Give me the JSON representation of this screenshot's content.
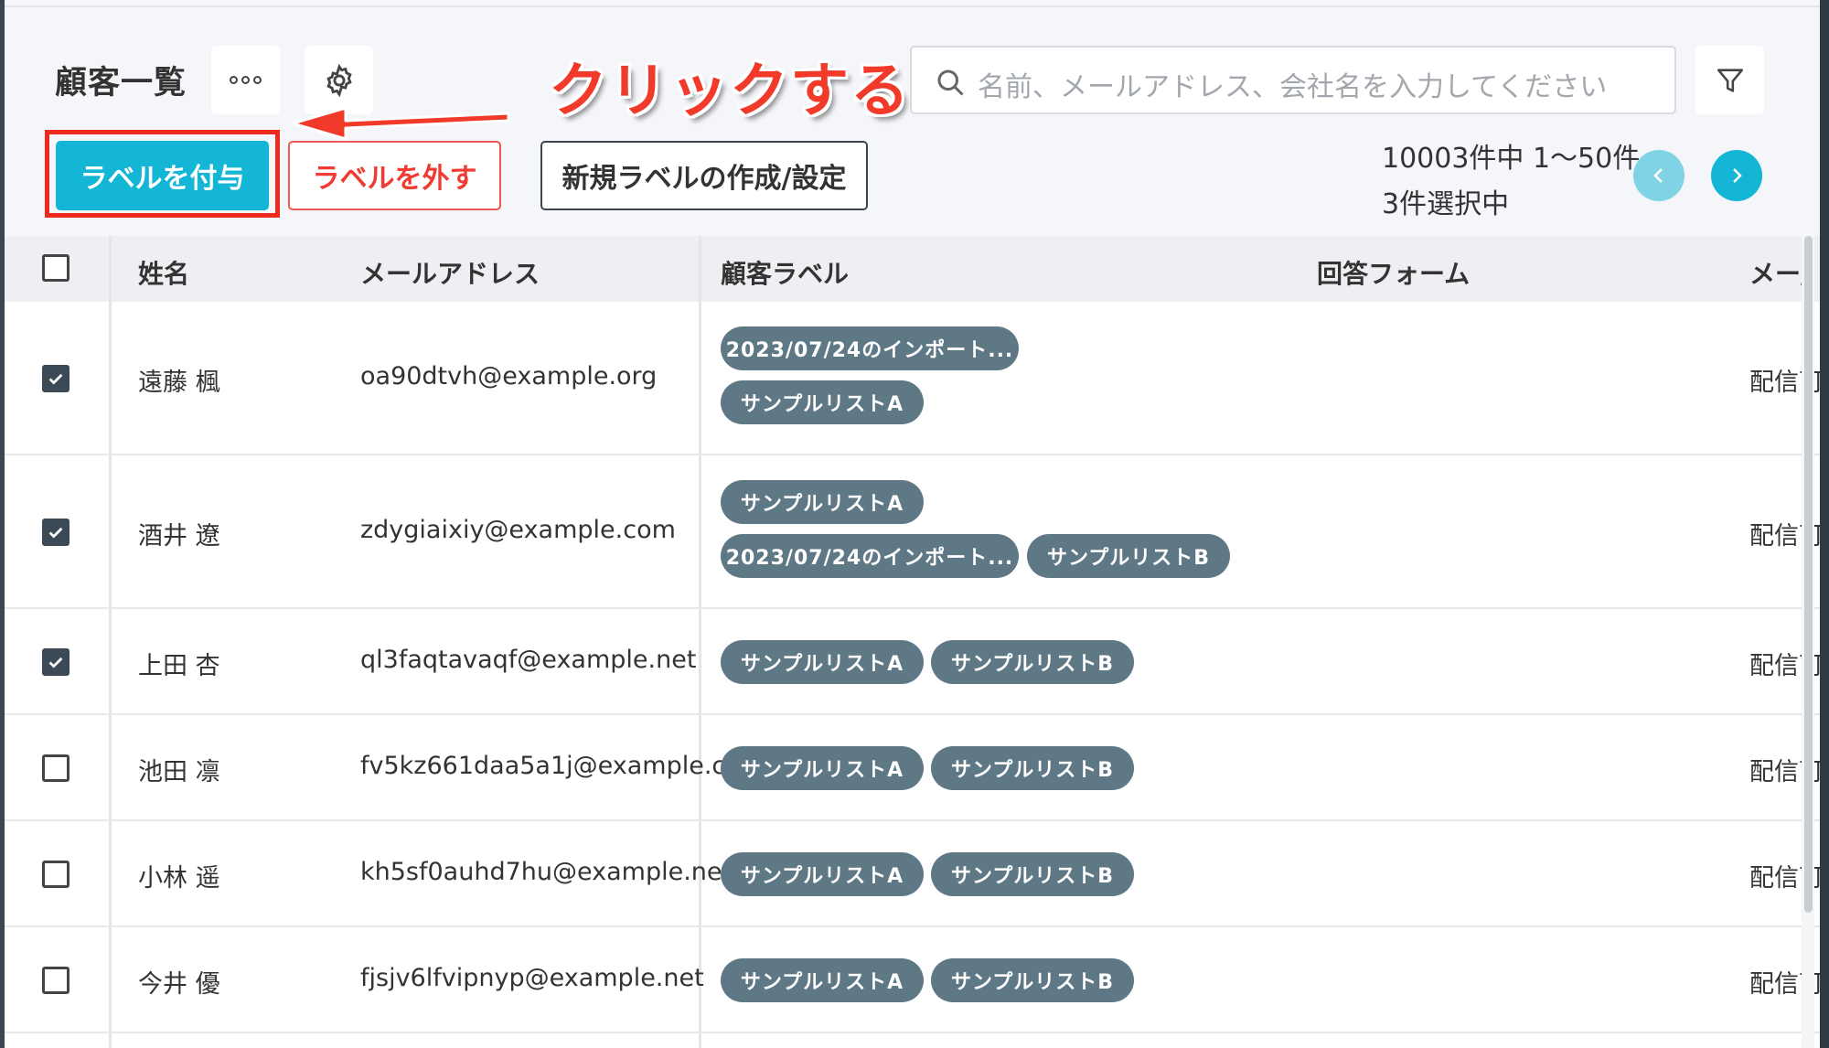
{
  "header": {
    "title": "顧客一覧",
    "annotation": "クリックする",
    "search_placeholder": "名前、メールアドレス、会社名を入力してください",
    "buttons": {
      "add_label": "ラベルを付与",
      "remove_label": "ラベルを外す",
      "new_label": "新規ラベルの作成/設定"
    },
    "count_text": "10003件中 1〜50件",
    "selected_text": "3件選択中"
  },
  "colors": {
    "accent": "#13b6d4",
    "danger": "#ef3b31",
    "annotation": "#f23a2a",
    "tag": "#5f7885"
  },
  "table": {
    "columns": [
      "姓名",
      "メールアドレス",
      "顧客ラベル",
      "回答フォーム",
      "メー/"
    ],
    "rows": [
      {
        "checked": true,
        "name": "遠藤 楓",
        "email": "oa90dtvh@example.org",
        "labels": [
          "2023/07/24のインポート...",
          "サンプルリストA"
        ],
        "mail_status": "配信可"
      },
      {
        "checked": true,
        "name": "酒井 遼",
        "email": "zdygiaixiy@example.com",
        "labels": [
          "サンプルリストA",
          "2023/07/24のインポート...",
          "サンプルリストB"
        ],
        "mail_status": "配信可"
      },
      {
        "checked": true,
        "name": "上田 杏",
        "email": "ql3faqtavaqf@example.net",
        "labels": [
          "サンプルリストA",
          "サンプルリストB"
        ],
        "mail_status": "配信可"
      },
      {
        "checked": false,
        "name": "池田 凛",
        "email": "fv5kz661daa5a1j@example.c...",
        "labels": [
          "サンプルリストA",
          "サンプルリストB"
        ],
        "mail_status": "配信可"
      },
      {
        "checked": false,
        "name": "小林 遥",
        "email": "kh5sf0auhd7hu@example.net",
        "labels": [
          "サンプルリストA",
          "サンプルリストB"
        ],
        "mail_status": "配信可"
      },
      {
        "checked": false,
        "name": "今井 優",
        "email": "fjsjv6lfvipnyp@example.net",
        "labels": [
          "サンプルリストA",
          "サンプルリストB"
        ],
        "mail_status": "配信可"
      }
    ]
  }
}
